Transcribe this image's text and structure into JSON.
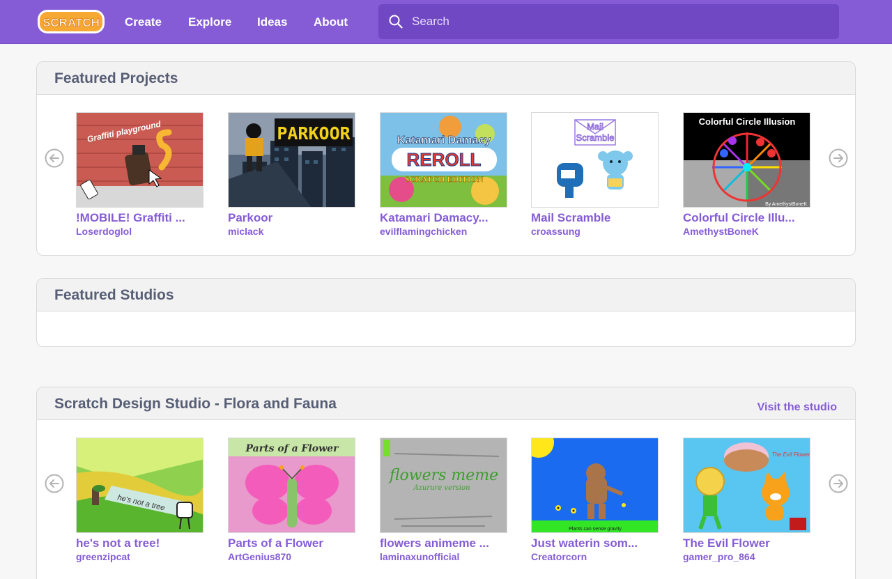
{
  "nav": {
    "logo_text": "SCRATCH",
    "links": [
      "Create",
      "Explore",
      "Ideas",
      "About"
    ],
    "search_placeholder": "Search"
  },
  "featured_projects": {
    "title": "Featured Projects",
    "items": [
      {
        "title": "!MOBILE! Graffiti ...",
        "author": "Loserdoglol",
        "thumb_text": "Graffiti playground"
      },
      {
        "title": "Parkoor",
        "author": "miclack",
        "thumb_text": "PARKOOR"
      },
      {
        "title": "Katamari Damacy...",
        "author": "evilflamingchicken",
        "thumb_text": "Katamari Damacy",
        "thumb_text2": "REROLL",
        "thumb_text3": "SCRATCH EDITION"
      },
      {
        "title": "Mail Scramble",
        "author": "croassung",
        "thumb_text": "Mail",
        "thumb_text2": "Scramble"
      },
      {
        "title": "Colorful Circle Illu...",
        "author": "AmethystBoneK",
        "thumb_text": "Colorful Circle Illusion",
        "thumb_text2": "By AmethystBoneK"
      }
    ]
  },
  "featured_studios": {
    "title": "Featured Studios"
  },
  "design_studio": {
    "title": "Scratch Design Studio - Flora and Fauna",
    "visit_label": "Visit the studio",
    "items": [
      {
        "title": "he's not a tree!",
        "author": "greenzipcat",
        "thumb_text": "he's not a tree"
      },
      {
        "title": "Parts of a Flower",
        "author": "ArtGenius870",
        "thumb_text": "Parts of a Flower"
      },
      {
        "title": "flowers animeme ...",
        "author": "laminaxunofficial",
        "thumb_text": "flowers meme",
        "thumb_text2": "Azurure version"
      },
      {
        "title": "Just waterin som...",
        "author": "Creatorcorn",
        "thumb_text": "Plants can sense gravity"
      },
      {
        "title": "The Evil Flower",
        "author": "gamer_pro_864",
        "thumb_text": "The Evil Flower"
      }
    ]
  },
  "colors": {
    "brand": "#855cd6",
    "search_bg": "#7148c4",
    "text": "#575e75",
    "link": "#855cd6"
  },
  "icons": [
    "search-icon",
    "arrow-left-icon",
    "arrow-right-icon"
  ]
}
